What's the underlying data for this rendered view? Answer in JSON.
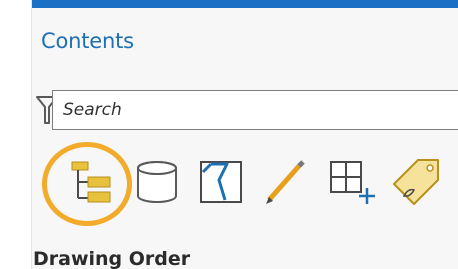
{
  "pane": {
    "title": "Contents"
  },
  "search": {
    "placeholder": "Search",
    "value": ""
  },
  "toolbar": {
    "icons": [
      "list-by-drawing-order-icon",
      "list-by-data-source-icon",
      "list-by-selection-icon",
      "list-by-editing-icon",
      "list-by-snapping-icon",
      "list-by-labeling-icon"
    ]
  },
  "section": {
    "header": "Drawing Order"
  },
  "colors": {
    "accent_bar": "#1a70c4",
    "title": "#1f6fb3",
    "highlight": "#f2ab2b",
    "folder_yellow": "#e8c23c"
  }
}
